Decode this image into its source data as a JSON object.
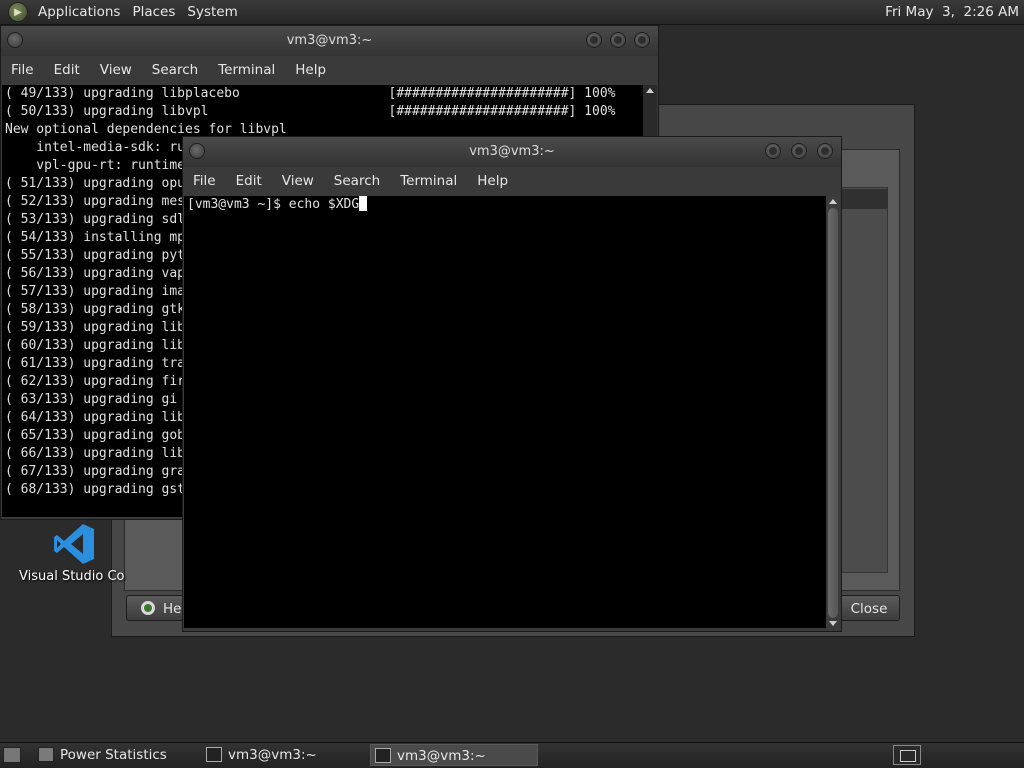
{
  "top_panel": {
    "menus": [
      "Applications",
      "Places",
      "System"
    ],
    "clock": "Fri May  3,  2:26 AM"
  },
  "desktop_icon": {
    "label": "Visual Studio Co",
    "icon": "vscode-icon",
    "accent_color": "#2b8fe0"
  },
  "power_window": {
    "help_label": "He",
    "close_label": "Close"
  },
  "terminal_back": {
    "title": "vm3@vm3:~",
    "menu": [
      "File",
      "Edit",
      "View",
      "Search",
      "Terminal",
      "Help"
    ],
    "lines": [
      "( 49/133) upgrading libplacebo                   [######################] 100%",
      "( 50/133) upgrading libvpl                       [######################] 100%",
      "New optional dependencies for libvpl",
      "    intel-media-sdk: ru",
      "    vpl-gpu-rt: runtime",
      "( 51/133) upgrading opu",
      "( 52/133) upgrading mes",
      "( 53/133) upgrading sdl",
      "( 54/133) installing mp",
      "( 55/133) upgrading pyt",
      "( 56/133) upgrading vap",
      "( 57/133) upgrading ima",
      "( 58/133) upgrading gtk",
      "( 59/133) upgrading lib",
      "( 60/133) upgrading lib",
      "( 61/133) upgrading tra",
      "( 62/133) upgrading fir",
      "( 63/133) upgrading gi",
      "( 64/133) upgrading lib",
      "( 65/133) upgrading gob",
      "( 66/133) upgrading lib",
      "( 67/133) upgrading gra",
      "( 68/133) upgrading gst"
    ]
  },
  "terminal_front": {
    "title": "vm3@vm3:~",
    "menu": [
      "File",
      "Edit",
      "View",
      "Search",
      "Terminal",
      "Help"
    ],
    "prompt": "[vm3@vm3 ~]$ ",
    "command": "echo $XDG"
  },
  "taskbar": {
    "tasks": [
      {
        "label": "Power Statistics",
        "icon": "power-statistics-icon",
        "active": false
      },
      {
        "label": "vm3@vm3:~",
        "icon": "terminal-icon",
        "active": false
      },
      {
        "label": "vm3@vm3:~",
        "icon": "terminal-icon",
        "active": true
      }
    ]
  }
}
